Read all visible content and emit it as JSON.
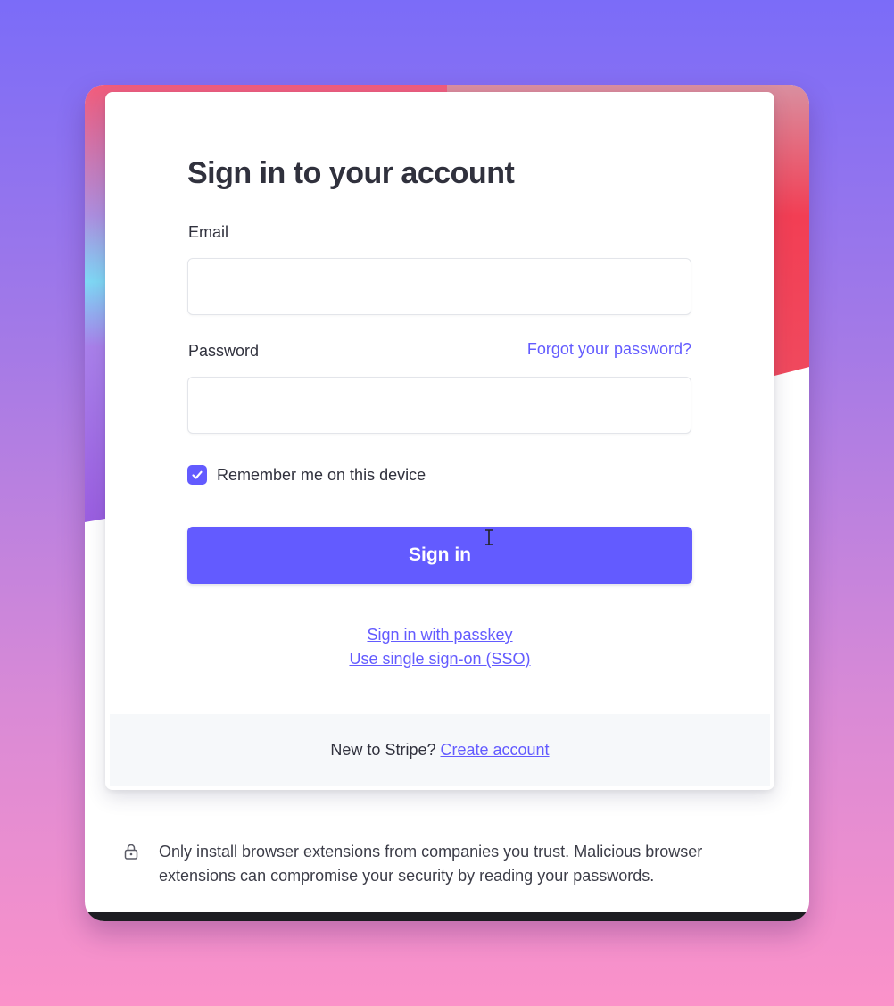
{
  "form": {
    "title": "Sign in to your account",
    "email_label": "Email",
    "email_value": "",
    "password_label": "Password",
    "password_value": "",
    "forgot_link": "Forgot your password?",
    "remember_label": "Remember me on this device",
    "remember_checked": true,
    "submit_label": "Sign in",
    "passkey_link": "Sign in with passkey",
    "sso_link": "Use single sign-on (SSO)"
  },
  "footer": {
    "prompt": "New to Stripe?",
    "create_link": "Create account"
  },
  "notice": {
    "text": "Only install browser extensions from companies you trust. Malicious browser extensions can compromise your security by reading your passwords."
  },
  "colors": {
    "accent": "#635bff",
    "text": "#30313d",
    "footer_bg": "#f6f8fa"
  },
  "icons": [
    "check-icon",
    "lock-icon",
    "text-cursor-icon"
  ]
}
